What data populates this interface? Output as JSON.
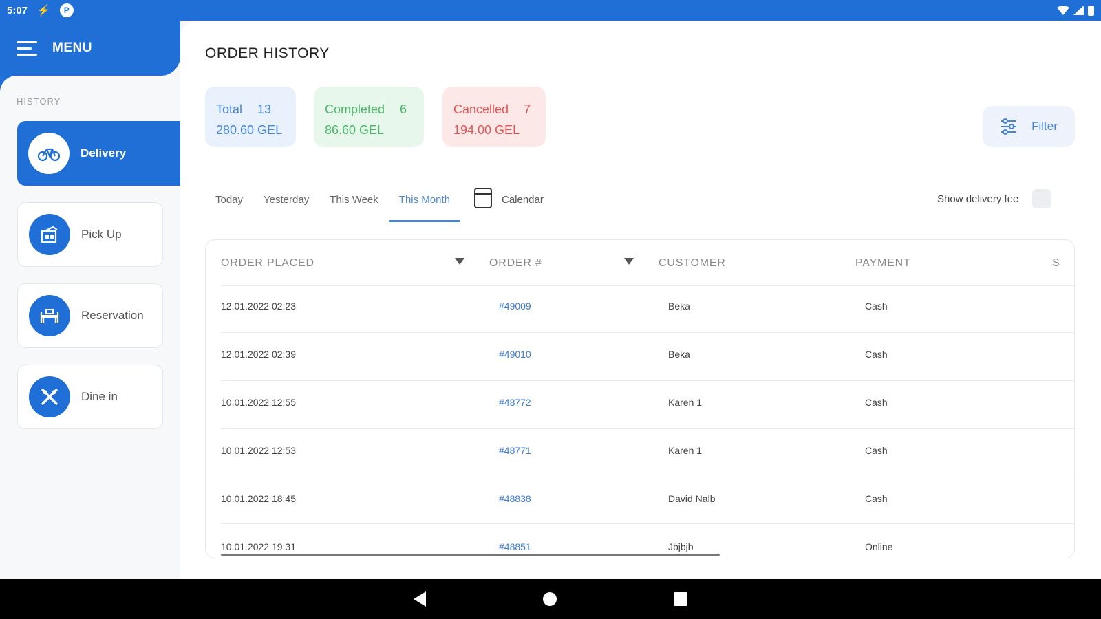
{
  "status_bar": {
    "time": "5:07",
    "bolt_glyph": "⚡",
    "app_glyph": "P"
  },
  "sidebar": {
    "menu_label": "MENU",
    "section_label": "HISTORY",
    "items": [
      {
        "label": "Delivery",
        "icon": "bicycle-icon",
        "active": true
      },
      {
        "label": "Pick Up",
        "icon": "pickup-store-icon",
        "active": false
      },
      {
        "label": "Reservation",
        "icon": "reservation-table-icon",
        "active": false
      },
      {
        "label": "Dine in",
        "icon": "fork-knife-icon",
        "active": false
      }
    ]
  },
  "main": {
    "title": "ORDER HISTORY",
    "stats": {
      "total": {
        "label": "Total",
        "count": "13",
        "amount": "280.60 GEL"
      },
      "completed": {
        "label": "Completed",
        "count": "6",
        "amount": "86.60 GEL"
      },
      "cancelled": {
        "label": "Cancelled",
        "count": "7",
        "amount": "194.00 GEL"
      }
    },
    "filter_label": "Filter",
    "tabs": [
      "Today",
      "Yesterday",
      "This Week",
      "This Month"
    ],
    "active_tab": "This Month",
    "calendar_label": "Calendar",
    "delivery_fee_label": "Show delivery fee",
    "table": {
      "columns": [
        "ORDER PLACED",
        "ORDER #",
        "CUSTOMER",
        "PAYMENT",
        "S"
      ],
      "rows": [
        {
          "placed": "12.01.2022 02:23",
          "order": "#49009",
          "customer": "Beka",
          "payment": "Cash"
        },
        {
          "placed": "12.01.2022 02:39",
          "order": "#49010",
          "customer": "Beka",
          "payment": "Cash"
        },
        {
          "placed": "10.01.2022 12:55",
          "order": "#48772",
          "customer": "Karen 1",
          "payment": "Cash"
        },
        {
          "placed": "10.01.2022 12:53",
          "order": "#48771",
          "customer": "Karen 1",
          "payment": "Cash"
        },
        {
          "placed": "10.01.2022 18:45",
          "order": "#48838",
          "customer": "David Nalb",
          "payment": "Cash"
        },
        {
          "placed": "10.01.2022 19:31",
          "order": "#48851",
          "customer": "Jbjbjb",
          "payment": "Online"
        }
      ]
    }
  },
  "colors": {
    "primary": "#1f6fd6",
    "accent": "#4a86d8",
    "success": "#4cb86a",
    "danger": "#e25454"
  }
}
